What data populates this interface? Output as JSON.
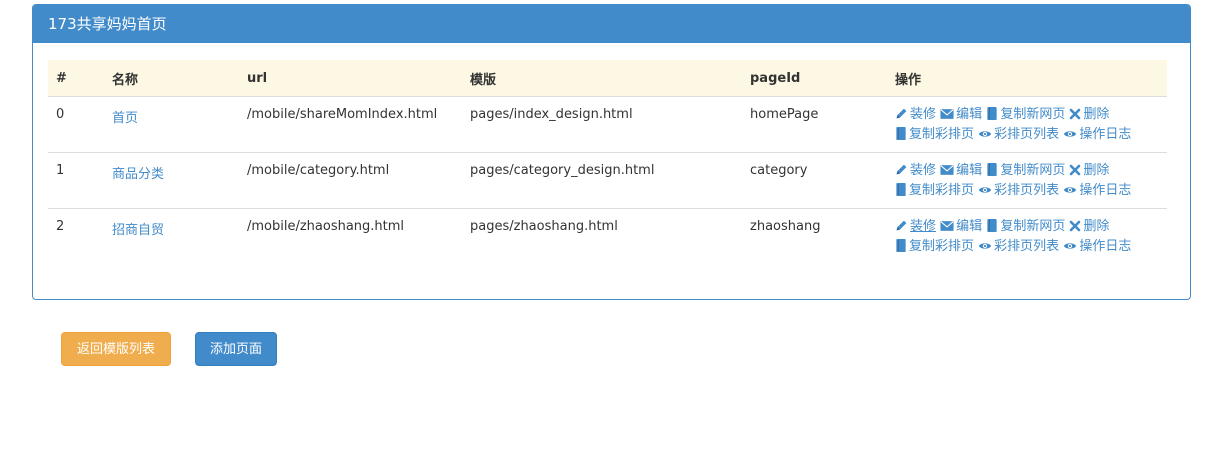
{
  "panel": {
    "title": "173共享妈妈首页"
  },
  "table": {
    "headers": {
      "index": "#",
      "name": "名称",
      "url": "url",
      "template": "模版",
      "pageid": "pageId",
      "ops": "操作"
    },
    "rows": [
      {
        "index": "0",
        "name": "首页",
        "url": "/mobile/shareMomIndex.html",
        "template": "pages/index_design.html",
        "pageid": "homePage"
      },
      {
        "index": "1",
        "name": "商品分类",
        "url": "/mobile/category.html",
        "template": "pages/category_design.html",
        "pageid": "category"
      },
      {
        "index": "2",
        "name": "招商自贸",
        "url": "/mobile/zhaoshang.html",
        "template": "pages/zhaoshang.html",
        "pageid": "zhaoshang"
      }
    ]
  },
  "ops": {
    "decorate": "装修",
    "edit": "编辑",
    "copy_new": "复制新网页",
    "delete": "删除",
    "copy_color": "复制彩排页",
    "color_list": "彩排页列表",
    "op_log": "操作日志"
  },
  "icons": {
    "decorate": "pencil-icon",
    "edit": "envelope-icon",
    "copy_new": "book-icon",
    "delete": "close-icon",
    "copy_color": "book-icon",
    "color_list": "eye-icon",
    "op_log": "eye-icon"
  },
  "buttons": {
    "back": "返回模版列表",
    "add": "添加页面"
  },
  "colors": {
    "primary": "#428bca",
    "warning": "#f0ad4e",
    "header_row": "#fcf8e3"
  }
}
